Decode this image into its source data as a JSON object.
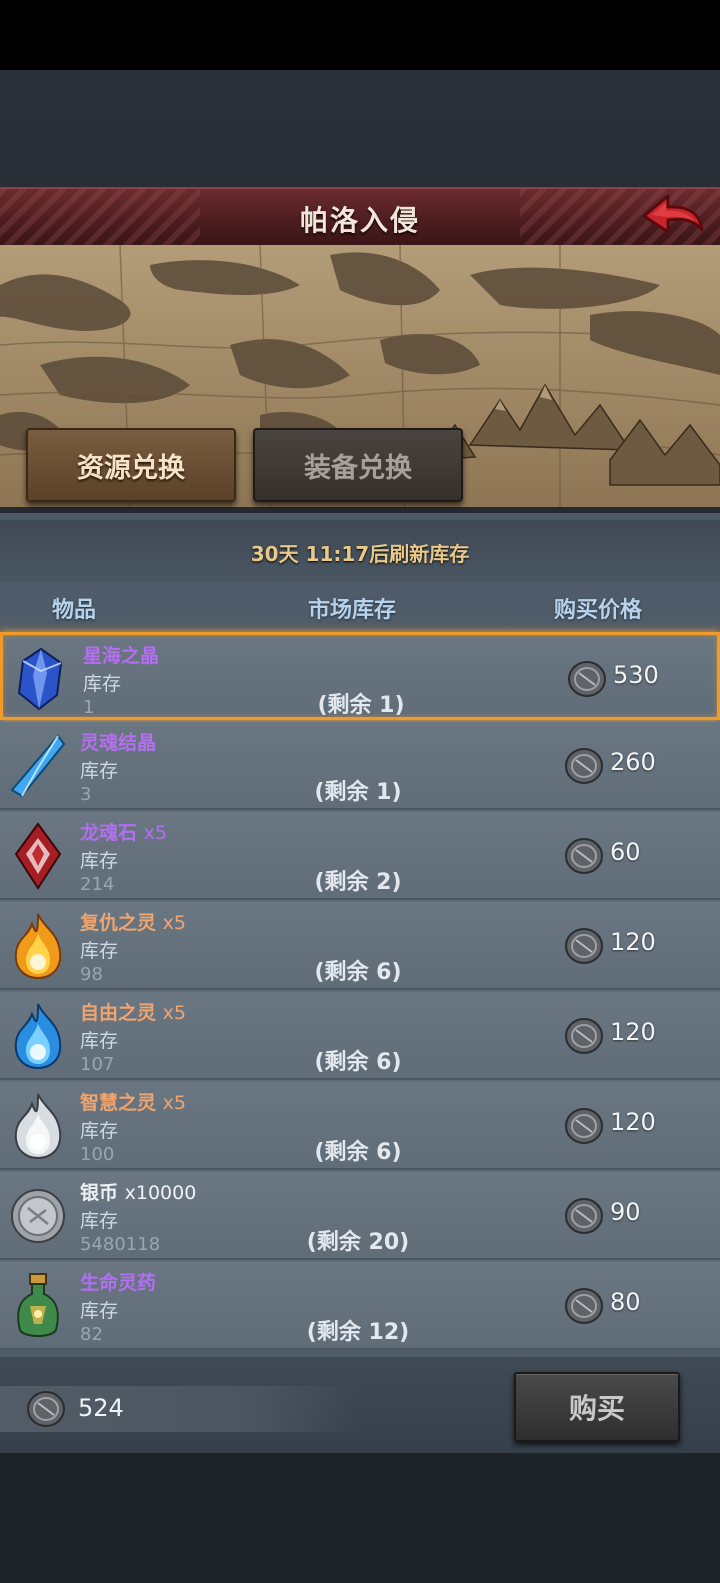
{
  "window": {
    "title": "帕洛入侵"
  },
  "tabs": [
    {
      "label": "资源兑换",
      "active": true
    },
    {
      "label": "装备兑换",
      "active": false
    }
  ],
  "timer_text": "30天 11:17后刷新库存",
  "columns": {
    "item": "物品",
    "market_stock": "市场库存",
    "price": "购买价格"
  },
  "items": [
    {
      "name": "星海之晶",
      "qty": "",
      "name_color": "purple",
      "icon": "blue-crystal-icon",
      "stock_label": "库存",
      "stock": "1",
      "remain": "(剩余 1)",
      "price": "530",
      "selected": true
    },
    {
      "name": "灵魂结晶",
      "qty": "",
      "name_color": "purple",
      "icon": "soul-crystal-icon",
      "stock_label": "库存",
      "stock": "3",
      "remain": "(剩余 1)",
      "price": "260",
      "selected": false
    },
    {
      "name": "龙魂石",
      "qty": "x5",
      "name_color": "purple",
      "icon": "dragon-soul-stone-icon",
      "stock_label": "库存",
      "stock": "214",
      "remain": "(剩余 2)",
      "price": "60",
      "selected": false
    },
    {
      "name": "复仇之灵",
      "qty": "x5",
      "name_color": "orange",
      "icon": "orange-flame-icon",
      "stock_label": "库存",
      "stock": "98",
      "remain": "(剩余 6)",
      "price": "120",
      "selected": false
    },
    {
      "name": "自由之灵",
      "qty": "x5",
      "name_color": "orange",
      "icon": "blue-flame-icon",
      "stock_label": "库存",
      "stock": "107",
      "remain": "(剩余 6)",
      "price": "120",
      "selected": false
    },
    {
      "name": "智慧之灵",
      "qty": "x5",
      "name_color": "orange",
      "icon": "white-flame-icon",
      "stock_label": "库存",
      "stock": "100",
      "remain": "(剩余 6)",
      "price": "120",
      "selected": false
    },
    {
      "name": "银币",
      "qty": "x10000",
      "name_color": "white",
      "icon": "silver-coin-icon",
      "stock_label": "库存",
      "stock": "5480118",
      "remain": "(剩余 20)",
      "price": "90",
      "selected": false
    },
    {
      "name": "生命灵药",
      "qty": "",
      "name_color": "purple",
      "icon": "life-potion-icon",
      "stock_label": "库存",
      "stock": "82",
      "remain": "(剩余 12)",
      "price": "80",
      "selected": false
    }
  ],
  "balance": "524",
  "buy_label": "购买",
  "colors": {
    "title_bar": "#5a2225",
    "selected_border": "#f09a2a",
    "purple_name": "#b36ff0",
    "orange_name": "#f0a46e",
    "timer": "#e8c98a",
    "header": "#b7d2ea"
  }
}
